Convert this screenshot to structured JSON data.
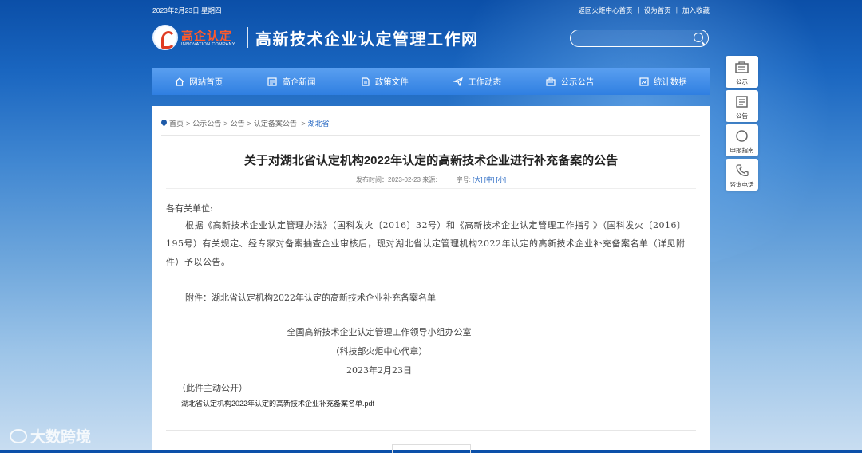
{
  "topbar": {
    "date": "2023年2月23日 星期四",
    "links": [
      "返回火炬中心首页",
      "设为首页",
      "加入收藏"
    ]
  },
  "logo": {
    "cn": "高企认定",
    "en": "INNOVATION COMPANY"
  },
  "site_title": "高新技术企业认定管理工作网",
  "search": {
    "placeholder": ""
  },
  "nav": [
    {
      "label": "网站首页",
      "icon": "home-icon"
    },
    {
      "label": "高企新闻",
      "icon": "news-icon"
    },
    {
      "label": "政策文件",
      "icon": "document-icon"
    },
    {
      "label": "工作动态",
      "icon": "paper-plane-icon"
    },
    {
      "label": "公示公告",
      "icon": "bulletin-icon"
    },
    {
      "label": "统计数据",
      "icon": "chart-icon"
    }
  ],
  "breadcrumb": [
    "首页",
    "公示公告",
    "公告",
    "认定备案公告"
  ],
  "breadcrumb_current": "湖北省",
  "article": {
    "title": "关于对湖北省认定机构2022年认定的高新技术企业进行补充备案的公告",
    "meta": "发布时间：2023-02-23 来源:",
    "size_label": "字号:",
    "sizes": [
      "[大]",
      "[中]",
      "[小]"
    ],
    "greeting": "各有关单位:",
    "paragraph": "根据《高新技术企业认定管理办法》（国科发火〔2016〕32号）和《高新技术企业认定管理工作指引》（国科发火〔2016〕195号）有关规定、经专家对备案抽查企业审核后，现对湖北省认定管理机构2022年认定的高新技术企业补充备案名单（详见附件）予以公告。",
    "attachment_line": "附件：湖北省认定机构2022年认定的高新技术企业补充备案名单",
    "signature_1": "全国高新技术企业认定管理工作领导小组办公室",
    "signature_2": "（科技部火炬中心代章）",
    "signature_date": "2023年2月23日",
    "public_note": "（此件主动公开）",
    "attachment_link": "湖北省认定机构2022年认定的高新技术企业补充备案名单.pdf"
  },
  "side_tools": [
    {
      "label": "公示",
      "icon": "bulletin-icon"
    },
    {
      "label": "公告",
      "icon": "notice-icon"
    },
    {
      "label": "申报指南",
      "icon": "compass-icon"
    },
    {
      "label": "咨询电话",
      "icon": "phone-icon"
    }
  ],
  "watermark": "大数跨境"
}
